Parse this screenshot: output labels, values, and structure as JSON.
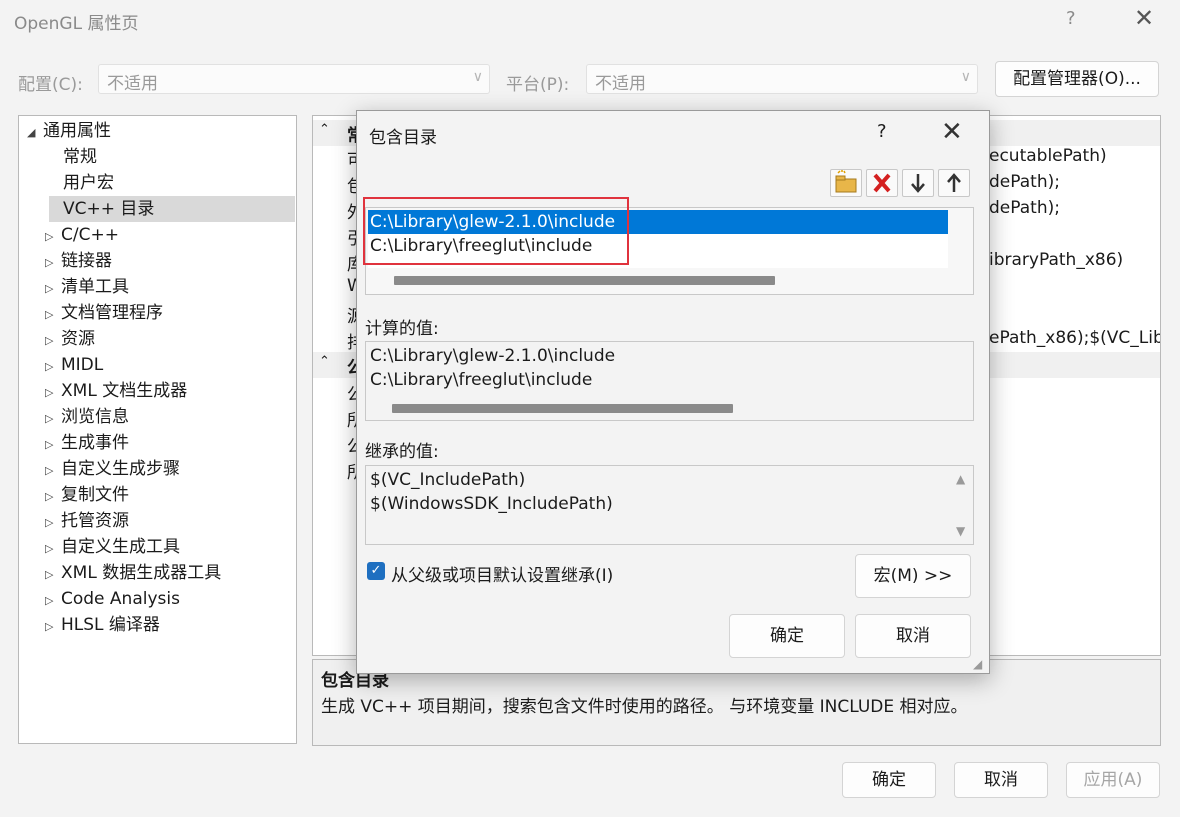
{
  "window": {
    "title": "OpenGL 属性页",
    "help": "?",
    "close": "✕"
  },
  "toolbar": {
    "config_label": "配置(C):",
    "config_value": "不适用",
    "platform_label": "平台(P):",
    "platform_value": "不适用",
    "config_manager": "配置管理器(O)..."
  },
  "tree": {
    "root": "通用属性",
    "items": [
      "常规",
      "用户宏",
      "VC++ 目录",
      "C/C++",
      "链接器",
      "清单工具",
      "文档管理程序",
      "资源",
      "MIDL",
      "XML 文档生成器",
      "浏览信息",
      "生成事件",
      "自定义生成步骤",
      "复制文件",
      "托管资源",
      "自定义生成工具",
      "XML 数据生成器工具",
      "Code Analysis",
      "HLSL 编译器"
    ]
  },
  "grid": {
    "section1_head": "常",
    "rows1": [
      "可",
      "包",
      "外",
      "引",
      "库",
      "W",
      "源",
      "排"
    ],
    "values1": [
      "ecutablePath)",
      "dePath);",
      "dePath);",
      "",
      "ibraryPath_x86)",
      "",
      "",
      "ePath_x86);$(VC_Lib"
    ],
    "section2_head": "公",
    "rows2": [
      "公",
      "所",
      "公",
      "所"
    ]
  },
  "description": {
    "title": "包含目录",
    "text": "生成 VC++ 项目期间，搜索包含文件时使用的路径。 与环境变量 INCLUDE 相对应。"
  },
  "dialog": {
    "title": "包含目录",
    "help": "?",
    "close": "✕",
    "entries": [
      "C:\\Library\\glew-2.1.0\\include",
      "C:\\Library\\freeglut\\include"
    ],
    "computed_label": "计算的值:",
    "computed": [
      "C:\\Library\\glew-2.1.0\\include",
      "C:\\Library\\freeglut\\include"
    ],
    "inherited_label": "继承的值:",
    "inherited": [
      "$(VC_IncludePath)",
      "$(WindowsSDK_IncludePath)"
    ],
    "inherit_checkbox": "从父级或项目默认设置继承(I)",
    "macros_button": "宏(M) >>",
    "ok": "确定",
    "cancel": "取消"
  },
  "footer": {
    "ok": "确定",
    "cancel": "取消",
    "apply": "应用(A)"
  },
  "colors": {
    "selection": "#0078d7",
    "highlight_box": "#e0333d",
    "checkbox": "#1e6fc0"
  }
}
